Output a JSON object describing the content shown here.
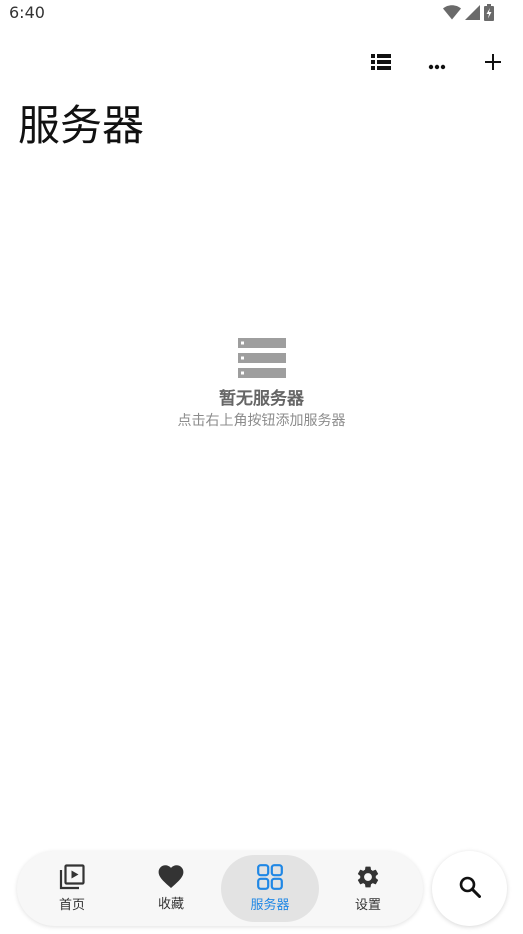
{
  "status_bar": {
    "time": "6:40",
    "icons": [
      "wifi-icon",
      "signal-icon",
      "battery-icon"
    ]
  },
  "toolbar": {
    "actions": [
      "list-view-icon",
      "more-icon",
      "add-icon"
    ]
  },
  "page": {
    "title": "服务器"
  },
  "empty_state": {
    "icon": "server-icon",
    "title": "暂无服务器",
    "hint": "点击右上角按钮添加服务器"
  },
  "bottom_nav": {
    "items": [
      {
        "label": "首页",
        "icon": "video-library-icon",
        "active": false
      },
      {
        "label": "收藏",
        "icon": "heart-icon",
        "active": false
      },
      {
        "label": "服务器",
        "icon": "grid-icon",
        "active": true
      },
      {
        "label": "设置",
        "icon": "gear-icon",
        "active": false
      }
    ]
  },
  "search_fab": {
    "icon": "search-icon"
  },
  "colors": {
    "accent": "#1f87e5",
    "nav_background": "#f7f7f7",
    "nav_active_background": "#e3e3e3",
    "empty_icon": "#9e9e9e"
  }
}
